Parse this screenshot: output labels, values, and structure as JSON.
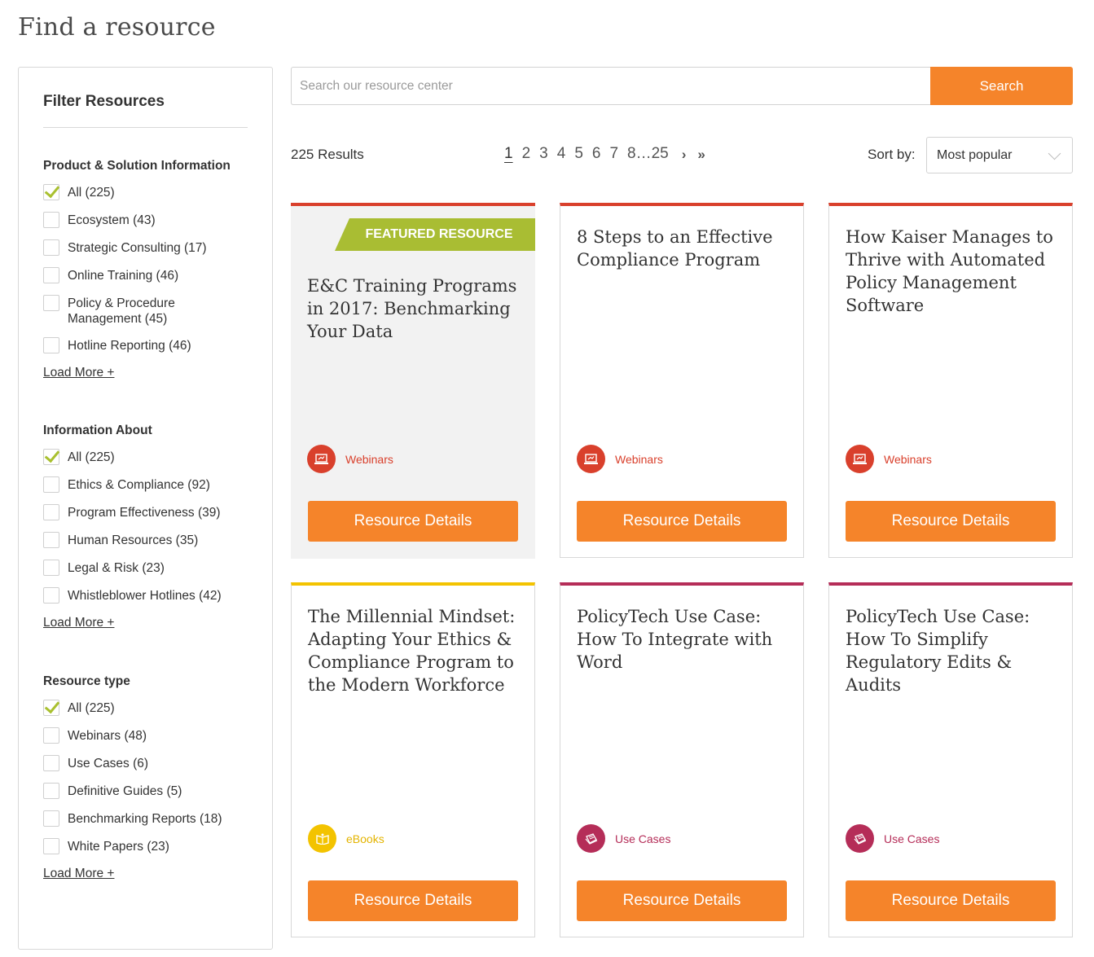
{
  "page": {
    "title": "Find a resource"
  },
  "sidebar": {
    "title": "Filter Resources",
    "groups": [
      {
        "heading": "Product & Solution Information",
        "options": [
          {
            "label": "All (225)",
            "checked": true
          },
          {
            "label": "Ecosystem (43)",
            "checked": false
          },
          {
            "label": "Strategic Consulting (17)",
            "checked": false
          },
          {
            "label": "Online Training (46)",
            "checked": false
          },
          {
            "label": "Policy & Procedure Management (45)",
            "checked": false
          },
          {
            "label": "Hotline Reporting (46)",
            "checked": false
          }
        ],
        "load_more": "Load More +"
      },
      {
        "heading": "Information About",
        "options": [
          {
            "label": "All (225)",
            "checked": true
          },
          {
            "label": "Ethics & Compliance (92)",
            "checked": false
          },
          {
            "label": "Program Effectiveness (39)",
            "checked": false
          },
          {
            "label": "Human Resources (35)",
            "checked": false
          },
          {
            "label": "Legal & Risk (23)",
            "checked": false
          },
          {
            "label": "Whistleblower Hotlines (42)",
            "checked": false
          }
        ],
        "load_more": "Load More +"
      },
      {
        "heading": "Resource type",
        "options": [
          {
            "label": "All (225)",
            "checked": true
          },
          {
            "label": "Webinars (48)",
            "checked": false
          },
          {
            "label": "Use Cases (6)",
            "checked": false
          },
          {
            "label": "Definitive Guides (5)",
            "checked": false
          },
          {
            "label": "Benchmarking Reports (18)",
            "checked": false
          },
          {
            "label": "White Papers (23)",
            "checked": false
          }
        ],
        "load_more": "Load More +"
      }
    ]
  },
  "search": {
    "placeholder": "Search our resource center",
    "value": "",
    "button_label": "Search"
  },
  "results": {
    "count_label": "225 Results",
    "pagination": {
      "pages": [
        "1",
        "2",
        "3",
        "4",
        "5",
        "6",
        "7",
        "8…25"
      ],
      "current": "1",
      "next": "›",
      "last": "»"
    },
    "sort": {
      "label": "Sort by:",
      "selected": "Most popular"
    }
  },
  "cards": [
    {
      "featured": true,
      "banner": "FEATURED RESOURCE",
      "title": "E&C Training Programs in 2017: Benchmarking Your Data",
      "type": "Webinars",
      "type_icon": "laptop-icon",
      "accent": "#d9402c",
      "button_label": "Resource Details"
    },
    {
      "featured": false,
      "title": "8 Steps to an Effective Compliance Program",
      "type": "Webinars",
      "type_icon": "laptop-icon",
      "accent": "#d9402c",
      "button_label": "Resource Details"
    },
    {
      "featured": false,
      "title": "How Kaiser Manages to Thrive with Automated Policy Management Software",
      "type": "Webinars",
      "type_icon": "laptop-icon",
      "accent": "#d9402c",
      "button_label": "Resource Details"
    },
    {
      "featured": false,
      "title": "The Millennial Mindset: Adapting Your Ethics & Compliance Program to the Modern Workforce",
      "type": "eBooks",
      "type_icon": "book-icon",
      "accent": "#f3c300",
      "button_label": "Resource Details"
    },
    {
      "featured": false,
      "title": "PolicyTech Use Case: How To Integrate with Word",
      "type": "Use Cases",
      "type_icon": "document-stack-icon",
      "accent": "#b52d58",
      "button_label": "Resource Details"
    },
    {
      "featured": false,
      "title": "PolicyTech Use Case: How To Simplify Regulatory Edits & Audits",
      "type": "Use Cases",
      "type_icon": "document-stack-icon",
      "accent": "#b52d58",
      "button_label": "Resource Details"
    }
  ]
}
